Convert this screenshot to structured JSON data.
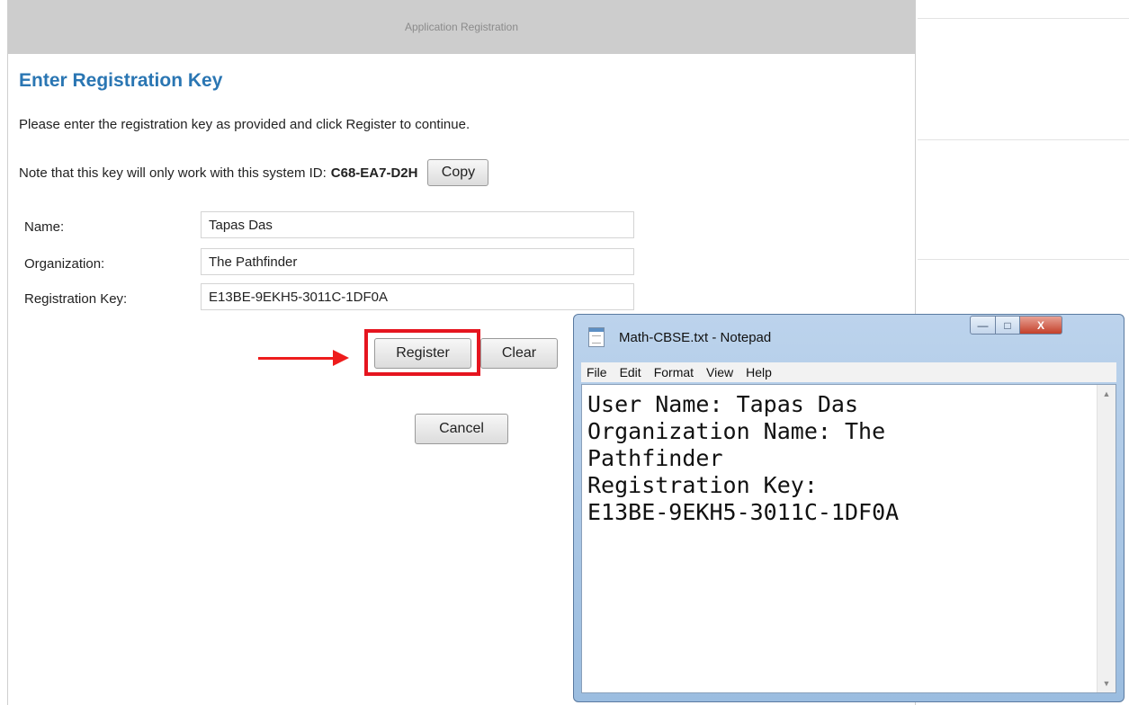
{
  "dialog": {
    "title": "Application Registration",
    "heading": "Enter Registration Key",
    "instructions": "Please enter the registration key as provided and click Register to continue.",
    "note_prefix": "Note that this key will only work with this system ID:",
    "system_id": "C68-EA7-D2H",
    "copy_label": "Copy",
    "fields": [
      {
        "label": "Name:",
        "value": "Tapas Das"
      },
      {
        "label": "Organization:",
        "value": "The Pathfinder"
      },
      {
        "label": "Registration Key:",
        "value": "E13BE-9EKH5-3011C-1DF0A"
      }
    ],
    "register_label": "Register",
    "clear_label": "Clear",
    "cancel_label": "Cancel",
    "highlight_color": "#e5151f"
  },
  "notepad": {
    "title": "Math-CBSE.txt - Notepad",
    "menu": [
      "File",
      "Edit",
      "Format",
      "View",
      "Help"
    ],
    "content": "User Name: Tapas Das\nOrganization Name: The\nPathfinder\nRegistration Key:\nE13BE-9EKH5-3011C-1DF0A",
    "icons": {
      "minimize": "minimize-icon",
      "maximize": "maximize-icon",
      "close": "close-icon"
    }
  }
}
